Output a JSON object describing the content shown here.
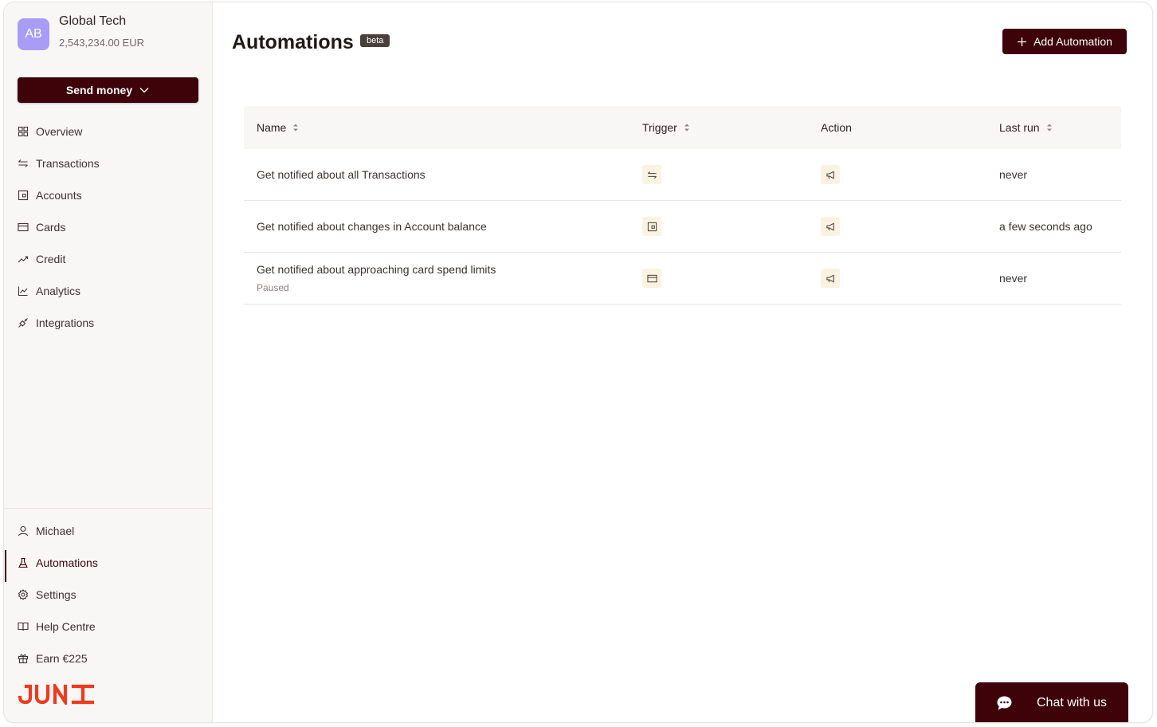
{
  "sidebar": {
    "avatar_initials": "AB",
    "org_name": "Global Tech",
    "balance": "2,543,234.00 EUR",
    "send_money_label": "Send money",
    "top_items": [
      {
        "label": "Overview",
        "icon": "grid-icon"
      },
      {
        "label": "Transactions",
        "icon": "arrows-swap-icon"
      },
      {
        "label": "Accounts",
        "icon": "wallet-icon"
      },
      {
        "label": "Cards",
        "icon": "credit-card-icon"
      },
      {
        "label": "Credit",
        "icon": "trending-up-icon"
      },
      {
        "label": "Analytics",
        "icon": "line-chart-icon"
      },
      {
        "label": "Integrations",
        "icon": "plug-icon"
      }
    ],
    "bottom_items": [
      {
        "label": "Michael",
        "icon": "user-icon"
      },
      {
        "label": "Automations",
        "icon": "flask-icon",
        "active": true
      },
      {
        "label": "Settings",
        "icon": "gear-icon"
      },
      {
        "label": "Help Centre",
        "icon": "book-icon"
      },
      {
        "label": "Earn €225",
        "icon": "gift-icon"
      }
    ],
    "logo_text": "JUNI"
  },
  "header": {
    "title": "Automations",
    "badge": "beta",
    "add_button_label": "Add Automation"
  },
  "table": {
    "columns": [
      "Name",
      "Trigger",
      "Action",
      "Last run"
    ],
    "rows": [
      {
        "name": "Get notified about all Transactions",
        "status": "",
        "trigger_icon": "arrows-swap-icon",
        "action_icon": "megaphone-icon",
        "last_run": "never"
      },
      {
        "name": "Get notified about changes in Account balance",
        "status": "",
        "trigger_icon": "wallet-icon",
        "action_icon": "megaphone-icon",
        "last_run": "a few seconds ago"
      },
      {
        "name": "Get notified about approaching card spend limits",
        "status": "Paused",
        "trigger_icon": "credit-card-icon",
        "action_icon": "megaphone-icon",
        "last_run": "never"
      }
    ]
  },
  "chat": {
    "label": "Chat with us"
  },
  "colors": {
    "brand": "#3e0309",
    "accent_logo": "#ee3a1d",
    "avatar": "#a99cf7",
    "chip_bg": "#fbf3e2"
  }
}
